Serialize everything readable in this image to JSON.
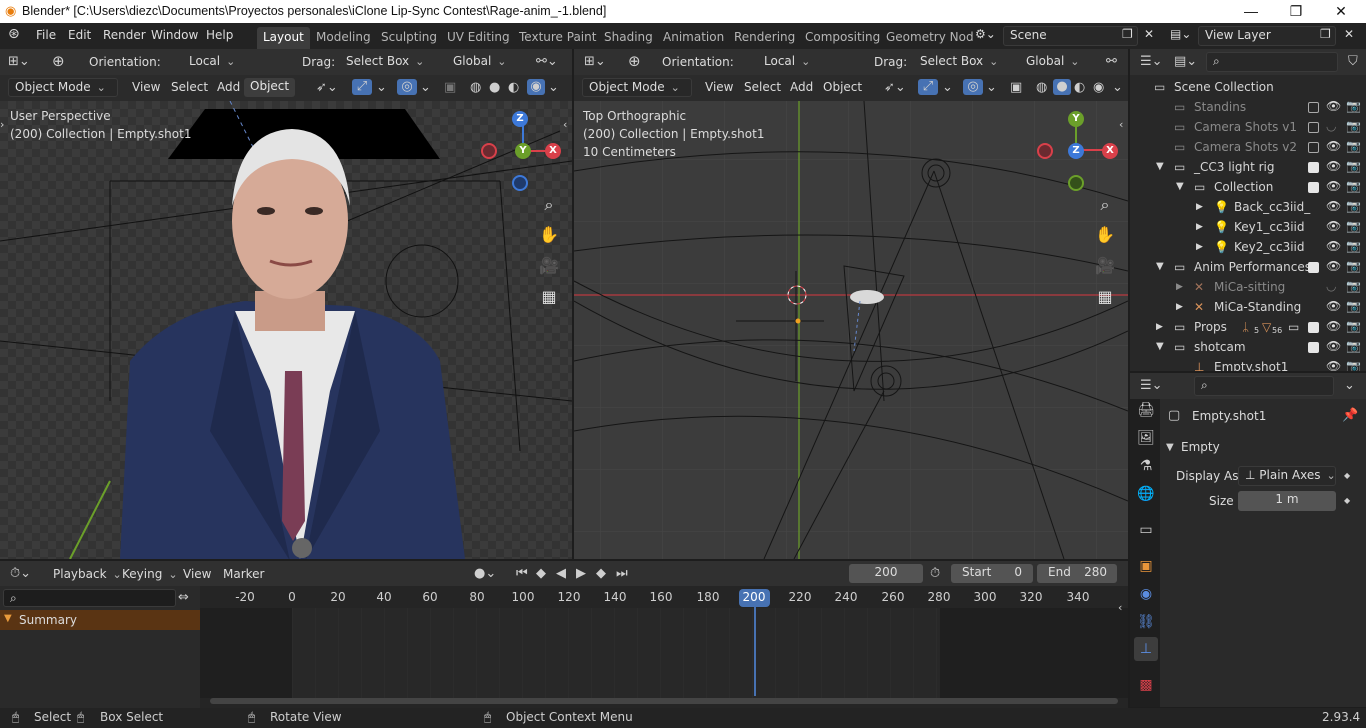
{
  "window": {
    "title": "Blender* [C:\\Users\\diezc\\Documents\\Proyectos personales\\iClone Lip-Sync Contest\\Rage-anim_-1.blend]",
    "minimize": "—",
    "maximize": "❐",
    "close": "✕"
  },
  "menu": {
    "items": [
      "File",
      "Edit",
      "Render",
      "Window",
      "Help"
    ],
    "workspaces": [
      "Layout",
      "Modeling",
      "Sculpting",
      "UV Editing",
      "Texture Paint",
      "Shading",
      "Animation",
      "Rendering",
      "Compositing",
      "Geometry Nod"
    ],
    "scene": "Scene",
    "view_layer": "View Layer"
  },
  "viewport_left": {
    "orientation_label": "Orientation:",
    "orientation": "Local",
    "drag_label": "Drag:",
    "drag": "Select Box",
    "transform": "Global",
    "mode": "Object Mode",
    "menus": [
      "View",
      "Select",
      "Add",
      "Object"
    ],
    "overlay_line1": "User Perspective",
    "overlay_line2": "(200) Collection | Empty.shot1",
    "axis_x": "X",
    "axis_y": "Y",
    "axis_z": "Z"
  },
  "viewport_right": {
    "orientation_label": "Orientation:",
    "orientation": "Local",
    "drag_label": "Drag:",
    "drag": "Select Box",
    "transform": "Global",
    "mode": "Object Mode",
    "menus": [
      "View",
      "Select",
      "Add",
      "Object"
    ],
    "overlay_line1": "Top Orthographic",
    "overlay_line2": "(200) Collection | Empty.shot1",
    "overlay_line3": "10 Centimeters",
    "axis_x": "X",
    "axis_y": "Y",
    "axis_z": "Z"
  },
  "outliner": {
    "rows": [
      {
        "label": "Scene Collection"
      },
      {
        "label": "Standins"
      },
      {
        "label": "Camera Shots v1"
      },
      {
        "label": "Camera Shots v2"
      },
      {
        "label": "_CC3 light rig"
      },
      {
        "label": "Collection"
      },
      {
        "label": "Back_cc3iid_"
      },
      {
        "label": "Key1_cc3iid"
      },
      {
        "label": "Key2_cc3iid"
      },
      {
        "label": "Anim Performances"
      },
      {
        "label": "MiCa-sitting"
      },
      {
        "label": "MiCa-Standing"
      },
      {
        "label": "Props"
      },
      {
        "label": "shotcam"
      },
      {
        "label": "Empty.shot1"
      }
    ],
    "props_count1": "5",
    "props_count2": "56"
  },
  "properties": {
    "object_name": "Empty.shot1",
    "panel_title": "Empty",
    "display_as_label": "Display As",
    "display_as": "Plain Axes",
    "size_label": "Size",
    "size": "1 m"
  },
  "timeline": {
    "menus": [
      "Playback",
      "Keying",
      "View",
      "Marker"
    ],
    "current_frame": "200",
    "start_label": "Start",
    "start": "0",
    "end_label": "End",
    "end": "280",
    "ticks": [
      "-20",
      "0",
      "20",
      "40",
      "60",
      "80",
      "100",
      "120",
      "140",
      "160",
      "180",
      "200",
      "220",
      "240",
      "260",
      "280",
      "300",
      "320",
      "340"
    ],
    "summary": "Summary"
  },
  "statusbar": {
    "select": "Select",
    "box_select": "Box Select",
    "rotate_view": "Rotate View",
    "context_menu": "Object Context Menu",
    "version": "2.93.4"
  },
  "colors": {
    "accent_blue": "#4772b3",
    "axis_red": "#d9404a",
    "axis_green": "#6b9f2a",
    "axis_blue": "#3d79d9",
    "summary_bg": "#5a3413"
  }
}
